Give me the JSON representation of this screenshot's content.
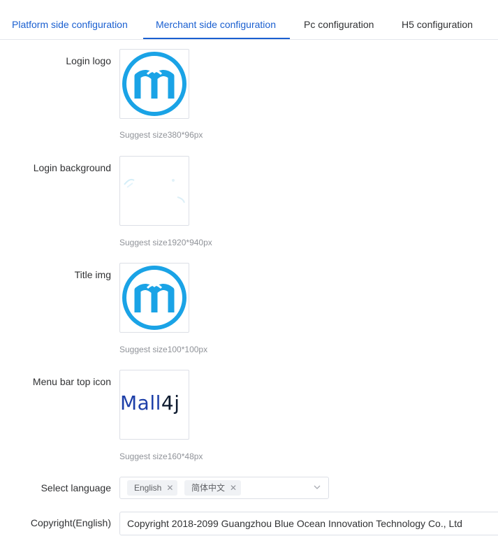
{
  "tabs": [
    {
      "label": "Platform side configuration",
      "active": false
    },
    {
      "label": "Merchant side configuration",
      "active": true
    },
    {
      "label": "Pc configuration",
      "active": false
    },
    {
      "label": "H5 configuration",
      "active": false
    }
  ],
  "form": {
    "login_logo": {
      "label": "Login logo",
      "hint": "Suggest size380*96px"
    },
    "login_background": {
      "label": "Login background",
      "hint": "Suggest size1920*940px"
    },
    "title_img": {
      "label": "Title img",
      "hint": "Suggest size100*100px"
    },
    "menu_bar_top_icon": {
      "label": "Menu bar top icon",
      "hint": "Suggest size160*48px",
      "logo_text_blue": "Mall",
      "logo_text_dark": "4j"
    },
    "select_language": {
      "label": "Select language",
      "tags": [
        "English",
        "简体中文"
      ],
      "remove_icon": "close-icon",
      "dropdown_icon": "chevron-down-icon"
    },
    "copyright_english": {
      "label": "Copyright(English)",
      "value": "Copyright 2018-2099 Guangzhou Blue Ocean Innovation Technology Co., Ltd"
    }
  },
  "colors": {
    "accent": "#1a5fd0",
    "logo_blue": "#1aa3e6",
    "mall4j_blue": "#1d3fa8",
    "mall4j_dark": "#0d1a2e"
  }
}
